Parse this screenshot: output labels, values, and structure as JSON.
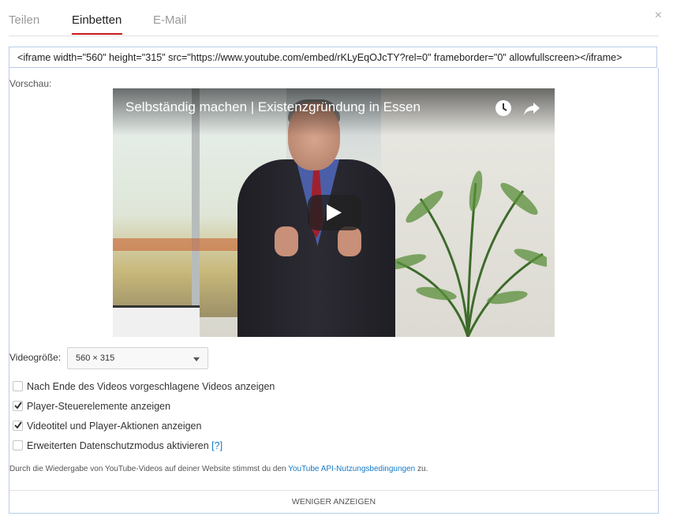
{
  "tabs": {
    "items": [
      {
        "label": "Teilen"
      },
      {
        "label": "Einbetten"
      },
      {
        "label": "E-Mail"
      }
    ],
    "active": "Einbetten"
  },
  "close_label": "×",
  "embed_code": "<iframe width=\"560\" height=\"315\" src=\"https://www.youtube.com/embed/rKLyEqOJcTY?rel=0\" frameborder=\"0\" allowfullscreen></iframe>",
  "preview": {
    "label": "Vorschau:",
    "video_title": "Selbständig machen | Existenzgründung in Essen",
    "icons": [
      "watch-later-icon",
      "share-icon",
      "play-icon"
    ]
  },
  "size": {
    "label": "Videogröße:",
    "selected": "560 × 315"
  },
  "options": [
    {
      "label": "Nach Ende des Videos vorgeschlagene Videos anzeigen",
      "checked": false
    },
    {
      "label": "Player-Steuerelemente anzeigen",
      "checked": true
    },
    {
      "label": "Videotitel und Player-Aktionen anzeigen",
      "checked": true
    },
    {
      "label": "Erweiterten Datenschutzmodus aktivieren",
      "checked": false,
      "help": "[?]"
    }
  ],
  "disclaimer": {
    "text": "Durch die Wiedergabe von YouTube-Videos auf deiner Website stimmst du den ",
    "link": "YouTube API-Nutzungsbedingungen",
    "suffix": " zu."
  },
  "footer": {
    "button_label": "WENIGER ANZEIGEN"
  },
  "colors": {
    "accent": "#cc181e",
    "link": "#167ac6",
    "border": "#b9cbe8"
  }
}
